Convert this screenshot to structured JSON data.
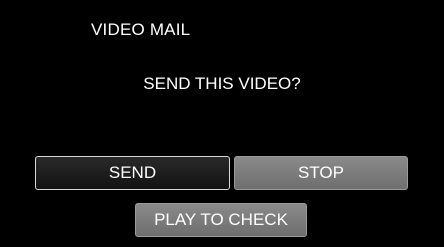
{
  "header": {
    "title": "VIDEO MAIL"
  },
  "dialog": {
    "question": "SEND THIS VIDEO?"
  },
  "buttons": {
    "send_label": "SEND",
    "stop_label": "STOP",
    "play_label": "PLAY TO CHECK"
  },
  "colors": {
    "background": "#000000",
    "text": "#ffffff",
    "selected_button": "#1a1a1a",
    "unselected_button": "#7a7a7a",
    "selected_border": "#d8d8d8"
  }
}
